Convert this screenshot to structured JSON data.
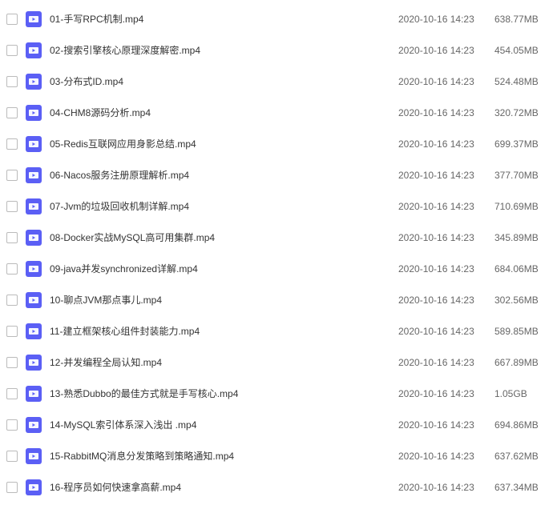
{
  "files": [
    {
      "name": "01-手写RPC机制.mp4",
      "date": "2020-10-16 14:23",
      "size": "638.77MB"
    },
    {
      "name": "02-搜索引擎核心原理深度解密.mp4",
      "date": "2020-10-16 14:23",
      "size": "454.05MB"
    },
    {
      "name": "03-分布式ID.mp4",
      "date": "2020-10-16 14:23",
      "size": "524.48MB"
    },
    {
      "name": "04-CHM8源码分析.mp4",
      "date": "2020-10-16 14:23",
      "size": "320.72MB"
    },
    {
      "name": "05-Redis互联网应用身影总结.mp4",
      "date": "2020-10-16 14:23",
      "size": "699.37MB"
    },
    {
      "name": "06-Nacos服务注册原理解析.mp4",
      "date": "2020-10-16 14:23",
      "size": "377.70MB"
    },
    {
      "name": "07-Jvm的垃圾回收机制详解.mp4",
      "date": "2020-10-16 14:23",
      "size": "710.69MB"
    },
    {
      "name": "08-Docker实战MySQL高可用集群.mp4",
      "date": "2020-10-16 14:23",
      "size": "345.89MB"
    },
    {
      "name": "09-java并发synchronized详解.mp4",
      "date": "2020-10-16 14:23",
      "size": "684.06MB"
    },
    {
      "name": "10-聊点JVM那点事儿.mp4",
      "date": "2020-10-16 14:23",
      "size": "302.56MB"
    },
    {
      "name": "11-建立框架核心组件封装能力.mp4",
      "date": "2020-10-16 14:23",
      "size": "589.85MB"
    },
    {
      "name": "12-并发编程全局认知.mp4",
      "date": "2020-10-16 14:23",
      "size": "667.89MB"
    },
    {
      "name": "13-熟悉Dubbo的最佳方式就是手写核心.mp4",
      "date": "2020-10-16 14:23",
      "size": "1.05GB"
    },
    {
      "name": "14-MySQL索引体系深入浅出 .mp4",
      "date": "2020-10-16 14:23",
      "size": "694.86MB"
    },
    {
      "name": "15-RabbitMQ消息分发策略到策略通知.mp4",
      "date": "2020-10-16 14:23",
      "size": "637.62MB"
    },
    {
      "name": "16-程序员如何快速拿高薪.mp4",
      "date": "2020-10-16 14:23",
      "size": "637.34MB"
    }
  ]
}
